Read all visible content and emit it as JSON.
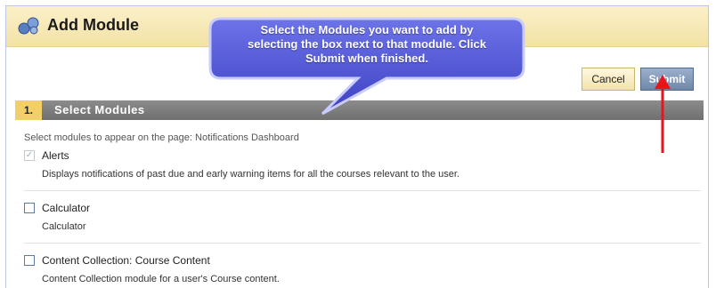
{
  "header": {
    "title": "Add Module",
    "icon": "puzzle-modules-icon"
  },
  "buttons": {
    "cancel": "Cancel",
    "submit": "Submit"
  },
  "callout": {
    "lines": [
      "Select the Modules you want to add by",
      "selecting the box next to that module.  Click",
      "Submit when finished."
    ]
  },
  "step": {
    "number": "1.",
    "title": "Select Modules"
  },
  "instructions": "Select modules to appear on the page: Notifications Dashboard",
  "modules": [
    {
      "title": "Alerts",
      "description": "Displays notifications of past due and early warning items for all the courses relevant to the user.",
      "checked": true,
      "disabled": true
    },
    {
      "title": "Calculator",
      "description": "Calculator",
      "checked": false,
      "disabled": false
    },
    {
      "title": "Content Collection: Course Content",
      "description": "Content Collection module for a user's Course content.",
      "checked": false,
      "disabled": false
    }
  ],
  "colors": {
    "callout_fill": "#4a4fd2",
    "arrow": "#e8151b",
    "step_bar": "#7a7a7a",
    "submit": "#6f87a9"
  }
}
